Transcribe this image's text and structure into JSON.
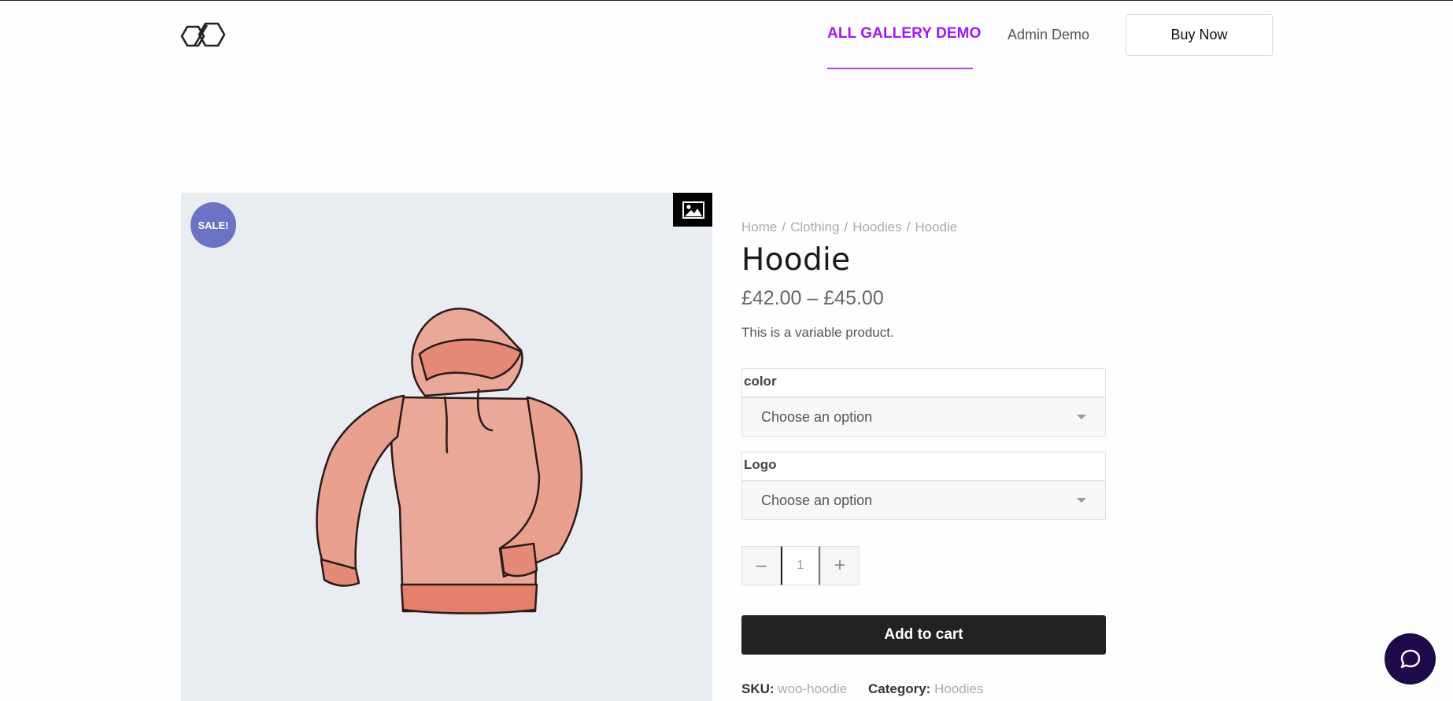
{
  "header": {
    "logo": "logo-icon",
    "nav": {
      "gallery_label": "ALL GALLERY DEMO",
      "admin_label": "Admin Demo"
    },
    "buy_now_label": "Buy Now"
  },
  "colors": {
    "accent": "#a316f0",
    "sale_badge": "#6b74c4",
    "cart_button": "#222222",
    "chat_button": "#1d0a4a"
  },
  "gallery": {
    "sale_badge": "SALE!",
    "zoom_icon": "image-icon",
    "product_image": "hoodie-illustration"
  },
  "breadcrumb": [
    "Home",
    "Clothing",
    "Hoodies",
    "Hoodie"
  ],
  "breadcrumb_sep": "/",
  "product": {
    "title": "Hoodie",
    "price": "£42.00 – £45.00",
    "description": "This is a variable product."
  },
  "attributes": [
    {
      "label": "color",
      "placeholder": "Choose an option"
    },
    {
      "label": "Logo",
      "placeholder": "Choose an option"
    }
  ],
  "quantity": {
    "minus": "–",
    "value": "1",
    "plus": "+"
  },
  "add_to_cart_label": "Add to cart",
  "meta": {
    "sku_label": "SKU:",
    "sku_value": "woo-hoodie",
    "category_label": "Category:",
    "category_value": "Hoodies"
  },
  "chat_icon": "chat-bubble-icon"
}
